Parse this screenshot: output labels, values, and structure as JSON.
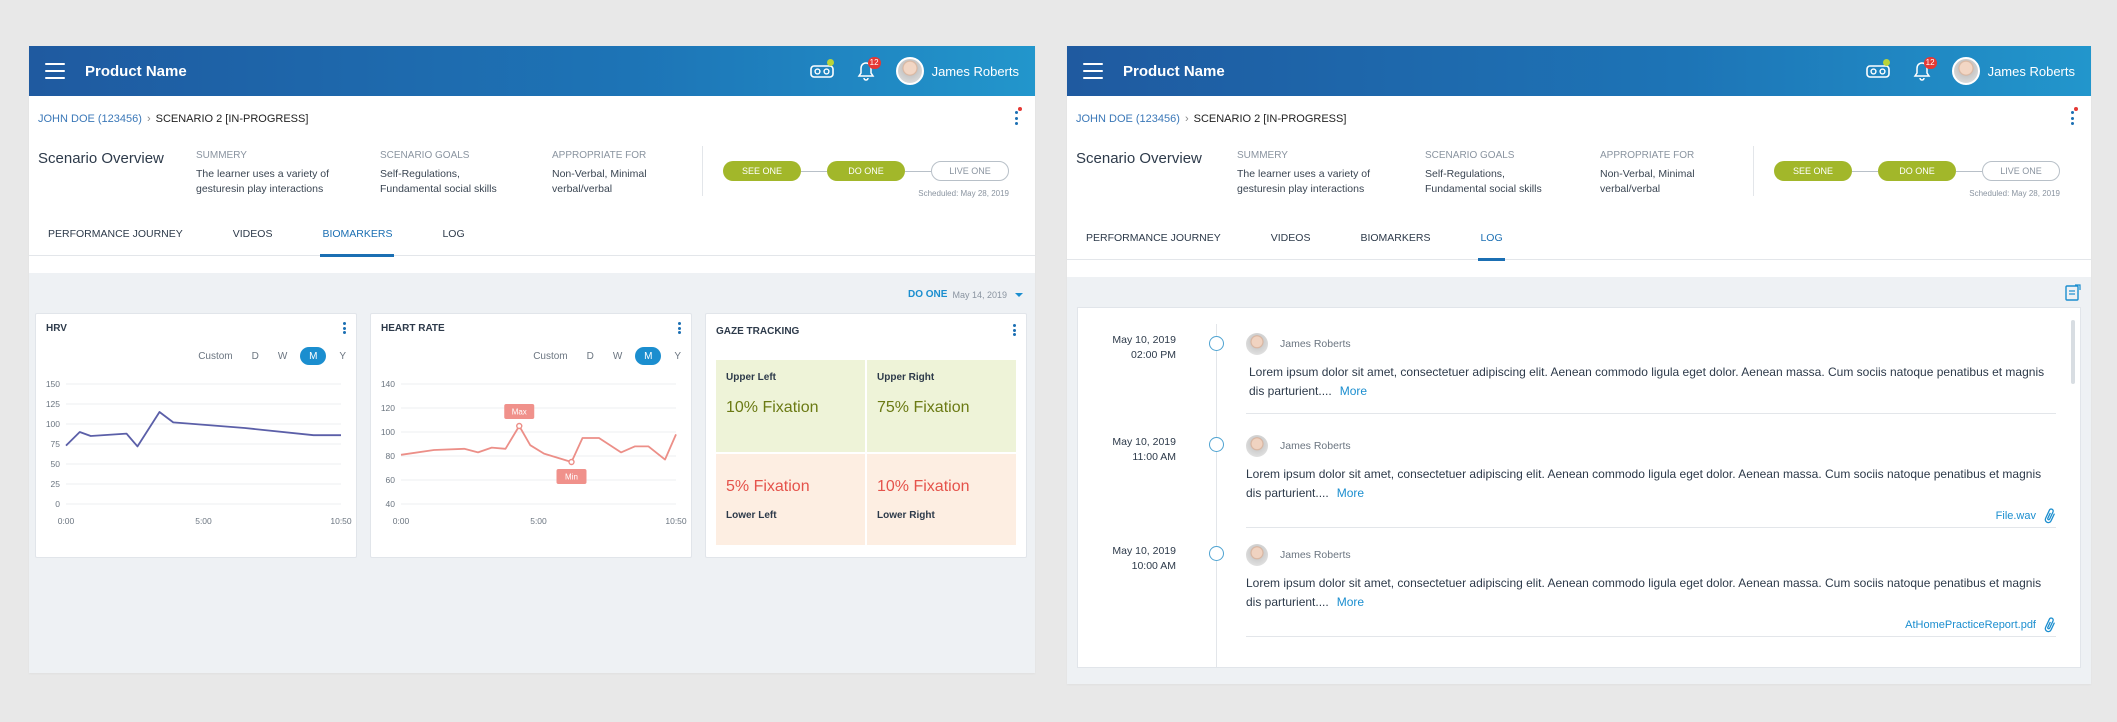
{
  "colors": {
    "header_start": "#1f5aa0",
    "header_end": "#2296cc",
    "accent": "#1b6fb3",
    "step_done": "#a2b72a",
    "hrv_line": "#5b5fa8",
    "hr_line": "#ec8f88",
    "badge": "#e53935"
  },
  "header": {
    "product_name": "Product Name",
    "notification_count": "12",
    "user_name": "James Roberts"
  },
  "breadcrumb": {
    "patient": "JOHN DOE (123456)",
    "scenario": "SCENARIO 2 [IN-PROGRESS]"
  },
  "overview": {
    "title": "Scenario Overview",
    "summary_label": "SUMMERY",
    "summary_text": "The learner uses a variety of gesturesin play interactions",
    "goals_label": "SCENARIO GOALS",
    "goals_text": "Self-Regulations, Fundamental social skills",
    "appropriate_label": "APPROPRIATE FOR",
    "appropriate_text": "Non-Verbal, Minimal verbal/verbal",
    "steps": [
      "SEE ONE",
      "DO ONE",
      "LIVE ONE"
    ],
    "scheduled": "Scheduled: May 28, 2019"
  },
  "tabs": [
    "PERFORMANCE JOURNEY",
    "VIDEOS",
    "BIOMARKERS",
    "LOG"
  ],
  "filter": {
    "value": "DO ONE",
    "date": "May 14, 2019"
  },
  "ranges": [
    "Custom",
    "D",
    "W",
    "M",
    "Y"
  ],
  "hrv": {
    "title": "HRV"
  },
  "heart_rate": {
    "title": "HEART RATE",
    "max_label": "Max",
    "min_label": "Min"
  },
  "gaze": {
    "title": "GAZE TRACKING",
    "upper_left_label": "Upper Left",
    "upper_left_value": "10% Fixation",
    "upper_right_label": "Upper Right",
    "upper_right_value": "75% Fixation",
    "lower_left_label": "Lower Left",
    "lower_left_value": "5% Fixation",
    "lower_right_label": "Lower Right",
    "lower_right_value": "10% Fixation"
  },
  "chart_data": [
    {
      "type": "line",
      "title": "HRV",
      "x_ticks": [
        "0:00",
        "5:00",
        "10:50"
      ],
      "y_ticks": [
        0,
        25,
        50,
        75,
        100,
        125,
        150
      ],
      "ylim": [
        0,
        150
      ],
      "xlim": [
        0,
        10
      ],
      "series": [
        {
          "x": [
            0,
            0.5,
            0.9,
            2.2,
            2.6,
            3.4,
            3.9,
            6.5,
            9.0,
            10.0
          ],
          "values": [
            73,
            90,
            85,
            88,
            72,
            115,
            102,
            95,
            86,
            86
          ]
        }
      ]
    },
    {
      "type": "line",
      "title": "HEART RATE",
      "x_ticks": [
        "0:00",
        "5:00",
        "10:50"
      ],
      "y_ticks": [
        40,
        60,
        80,
        100,
        120,
        140
      ],
      "ylim": [
        40,
        140
      ],
      "xlim": [
        0,
        10
      ],
      "series": [
        {
          "x": [
            0,
            1.2,
            2.3,
            2.8,
            3.3,
            3.8,
            4.3,
            4.7,
            5.2,
            6.2,
            6.6,
            7.2,
            8.0,
            8.5,
            9.0,
            9.6,
            10.0
          ],
          "values": [
            81,
            85,
            86,
            83,
            87,
            86,
            105,
            89,
            82,
            75,
            95,
            95,
            83,
            88,
            88,
            77,
            98
          ]
        }
      ],
      "annotations": [
        "Max",
        "Min"
      ]
    }
  ],
  "log": {
    "entries": [
      {
        "date": "May 10, 2019",
        "time": "02:00 PM",
        "author": "James Roberts",
        "text": "Lorem ipsum dolor sit amet, consectetuer adipiscing elit. Aenean commodo ligula eget dolor. Aenean massa. Cum sociis natoque penatibus et magnis dis parturient....",
        "more": "More",
        "attachment": ""
      },
      {
        "date": "May 10, 2019",
        "time": "11:00 AM",
        "author": "James Roberts",
        "text": "Lorem ipsum dolor sit amet, consectetuer adipiscing elit. Aenean commodo ligula eget dolor. Aenean massa. Cum sociis natoque penatibus et magnis dis parturient....",
        "more": "More",
        "attachment": "File.wav"
      },
      {
        "date": "May 10, 2019",
        "time": "10:00 AM",
        "author": "James Roberts",
        "text": "Lorem ipsum dolor sit amet, consectetuer adipiscing elit. Aenean commodo ligula eget dolor. Aenean massa. Cum sociis natoque penatibus et magnis dis parturient....",
        "more": "More",
        "attachment": "AtHomePracticeReport.pdf"
      }
    ]
  }
}
